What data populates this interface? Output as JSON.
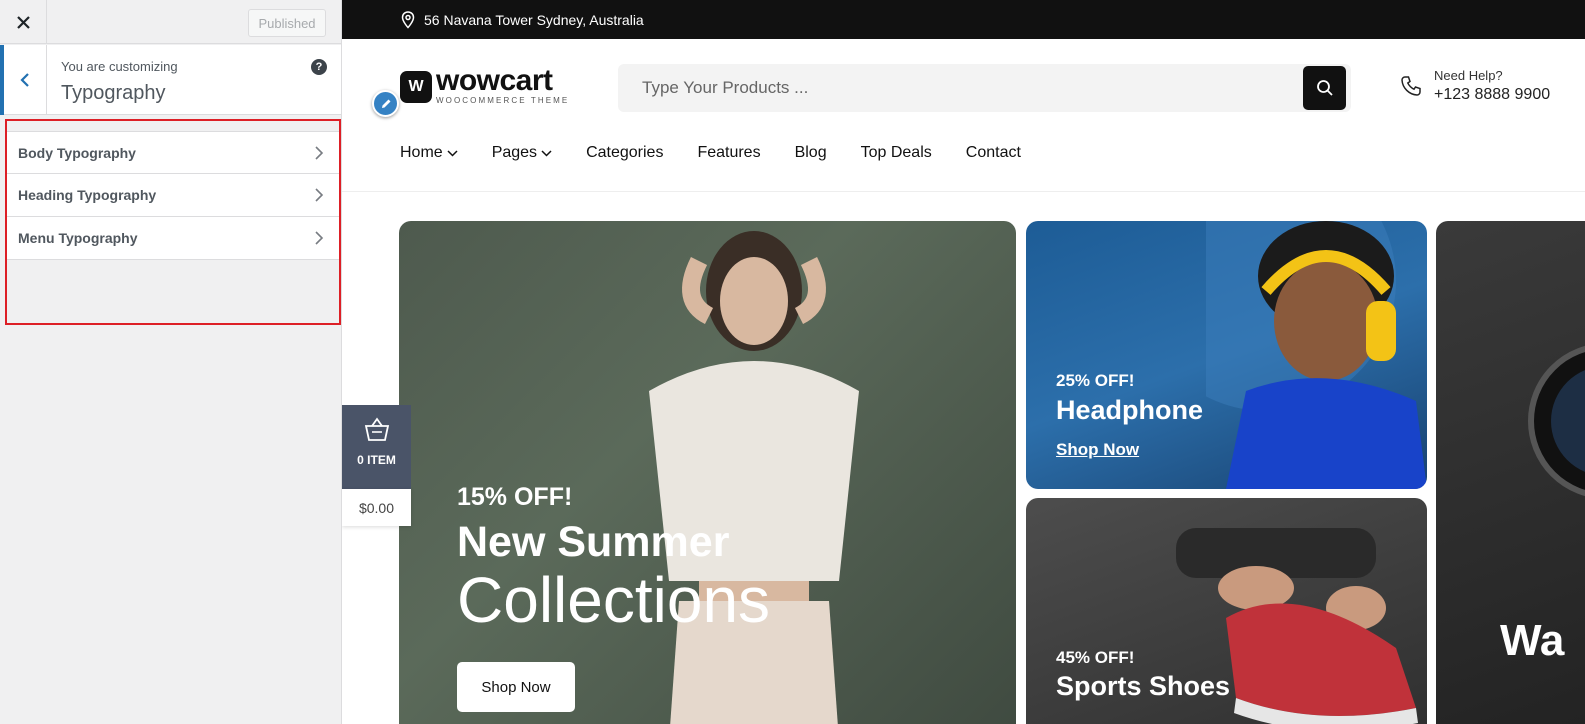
{
  "sidebar": {
    "close_icon": "close-icon",
    "publish_label": "Published",
    "customizing_label": "You are customizing",
    "section_title": "Typography",
    "help_label": "?",
    "items": [
      {
        "label": "Body Typography"
      },
      {
        "label": "Heading Typography"
      },
      {
        "label": "Menu Typography"
      }
    ],
    "highlight_color": "#dd1f26",
    "accent_color": "#2271b1"
  },
  "site": {
    "address": "56 Navana Tower Sydney, Australia",
    "logo_mark": "W",
    "logo_text": "wowcart",
    "logo_sub": "WOOCOMMERCE THEME",
    "search_placeholder": "Type Your Products ...",
    "help_title": "Need Help?",
    "help_phone": "+123 8888 9900",
    "nav": [
      {
        "label": "Home",
        "dropdown": true
      },
      {
        "label": "Pages",
        "dropdown": true
      },
      {
        "label": "Categories",
        "dropdown": false
      },
      {
        "label": "Features",
        "dropdown": false
      },
      {
        "label": "Blog",
        "dropdown": false
      },
      {
        "label": "Top Deals",
        "dropdown": false
      },
      {
        "label": "Contact",
        "dropdown": false
      }
    ],
    "cart": {
      "count": "0 ITEM",
      "total": "$0.00"
    },
    "banners": {
      "main": {
        "off": "15% OFF!",
        "title1": "New Summer",
        "title2": "Collections",
        "button": "Shop Now"
      },
      "headphone": {
        "off": "25% OFF!",
        "title": "Headphone",
        "link": "Shop Now"
      },
      "shoes": {
        "off": "45% OFF!",
        "title": "Sports Shoes"
      },
      "watch": {
        "title": "Wa"
      }
    }
  }
}
